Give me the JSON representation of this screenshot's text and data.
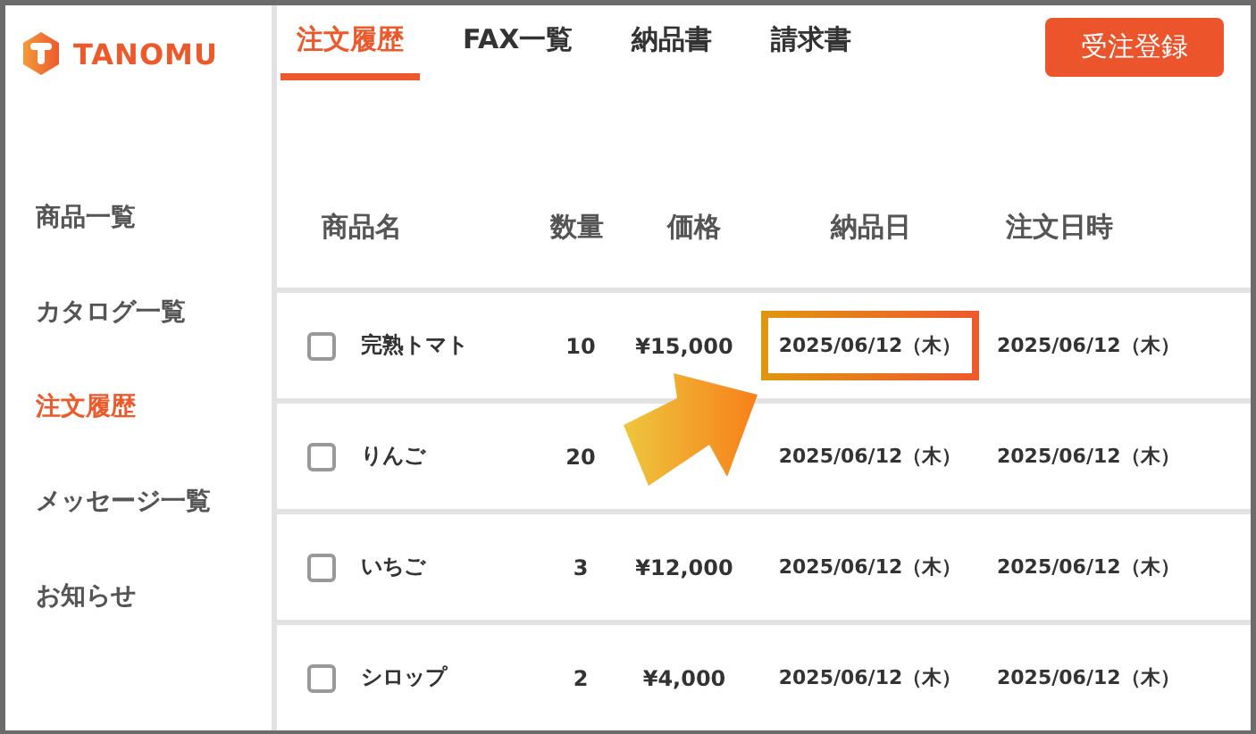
{
  "logo": {
    "name": "TANOMU"
  },
  "tabs": [
    {
      "label": "注文履歴",
      "selected": true
    },
    {
      "label": "FAX一覧",
      "selected": false
    },
    {
      "label": "納品書",
      "selected": false
    },
    {
      "label": "請求書",
      "selected": false
    }
  ],
  "primary_button": "受注登録",
  "sidebar": {
    "items": [
      {
        "label": "商品一覧",
        "selected": false
      },
      {
        "label": "カタログ一覧",
        "selected": false
      },
      {
        "label": "注文履歴",
        "selected": true
      },
      {
        "label": "メッセージ一覧",
        "selected": false
      },
      {
        "label": "お知らせ",
        "selected": false
      }
    ]
  },
  "table": {
    "columns": [
      "商品名",
      "数量",
      "価格",
      "納品日",
      "注文日時"
    ],
    "rows": [
      {
        "checked": false,
        "name": "完熟トマト",
        "quantity": "10",
        "price": "¥15,000",
        "delivery_date": "2025/06/12（木）",
        "delivery_highlighted": true,
        "order_date": "2025/06/12（木）"
      },
      {
        "checked": false,
        "name": "りんご",
        "quantity": "20",
        "delivery_date": "2025/06/12（木）",
        "delivery_highlighted": false,
        "order_date": "2025/06/12（木）"
      },
      {
        "checked": false,
        "name": "いちご",
        "quantity": "3",
        "price": "¥12,000",
        "delivery_date": "2025/06/12（木）",
        "delivery_highlighted": false,
        "order_date": "2025/06/12（木）"
      },
      {
        "checked": false,
        "name": "シロップ",
        "quantity": "2",
        "price": "¥4,000",
        "delivery_date": "2025/06/12（木）",
        "delivery_highlighted": false,
        "order_date": "2025/06/12（木）"
      }
    ]
  }
}
